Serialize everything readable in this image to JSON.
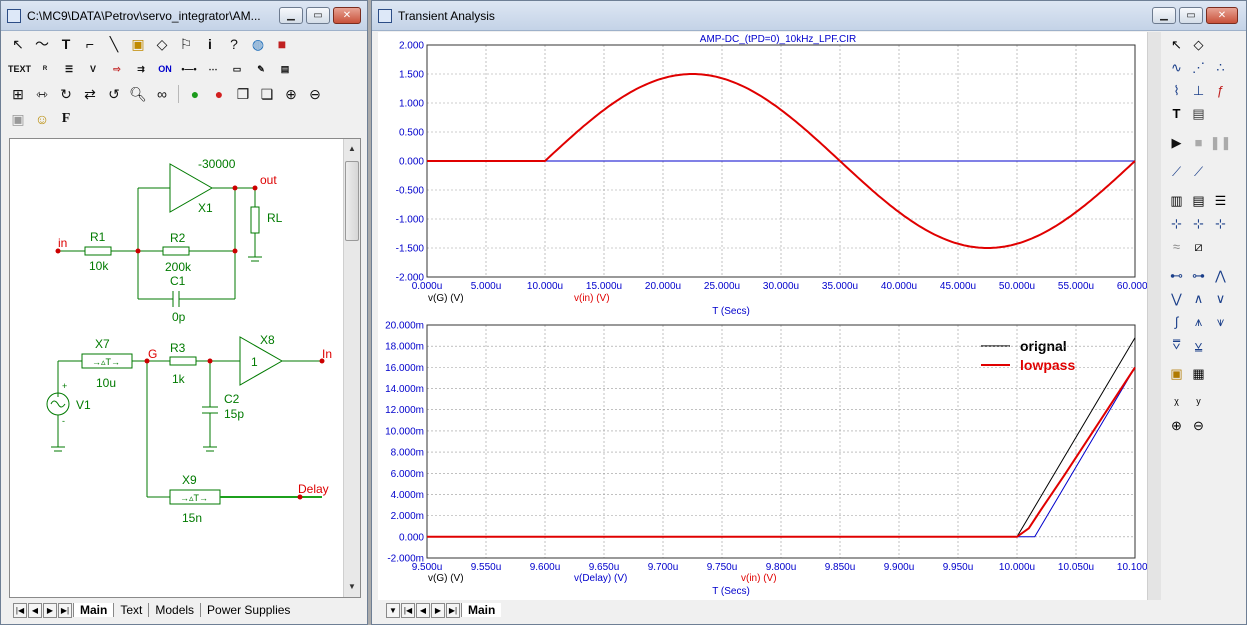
{
  "schematic_window": {
    "title": "C:\\MC9\\DATA\\Petrov\\servo_integrator\\AM...",
    "tabs": [
      "Main",
      "Text",
      "Models",
      "Power Supplies"
    ],
    "components": {
      "x1": {
        "name": "X1",
        "gain": "-30000"
      },
      "r1": {
        "name": "R1",
        "value": "10k"
      },
      "r2": {
        "name": "R2",
        "value": "200k"
      },
      "c1": {
        "name": "C1",
        "value": "0p"
      },
      "rl": {
        "name": "RL"
      },
      "x7": {
        "name": "X7",
        "value": "10u"
      },
      "r3": {
        "name": "R3",
        "value": "1k"
      },
      "c2": {
        "name": "C2",
        "value": "15p"
      },
      "x8": {
        "name": "X8",
        "gain": "1"
      },
      "v1": {
        "name": "V1"
      },
      "x9": {
        "name": "X9",
        "value": "15n"
      }
    },
    "nodes": {
      "in": "in",
      "out": "out",
      "g": "G",
      "in2": "In",
      "delay": "Delay"
    }
  },
  "analysis_window": {
    "title": "Transient Analysis",
    "tabs": [
      "Main"
    ],
    "plot1": {
      "title": "AMP-DC_(tPD=0)_10kHz_LPF.CIR",
      "y_ticks": [
        "2.000",
        "1.500",
        "1.000",
        "0.500",
        "0.000",
        "-0.500",
        "-1.000",
        "-1.500",
        "-2.000"
      ],
      "x_ticks": [
        "0.000u",
        "5.000u",
        "10.000u",
        "15.000u",
        "20.000u",
        "25.000u",
        "30.000u",
        "35.000u",
        "40.000u",
        "45.000u",
        "50.000u",
        "55.000u",
        "60.000u"
      ],
      "trace_labels": [
        "v(G) (V)",
        "v(in) (V)"
      ],
      "xlabel": "T (Secs)"
    },
    "plot2": {
      "y_ticks": [
        "20.000m",
        "18.000m",
        "16.000m",
        "14.000m",
        "12.000m",
        "10.000m",
        "8.000m",
        "6.000m",
        "4.000m",
        "2.000m",
        "0.000",
        "-2.000m"
      ],
      "x_ticks": [
        "9.500u",
        "9.550u",
        "9.600u",
        "9.650u",
        "9.700u",
        "9.750u",
        "9.800u",
        "9.850u",
        "9.900u",
        "9.950u",
        "10.000u",
        "10.050u",
        "10.100u"
      ],
      "trace_labels": [
        "v(G) (V)",
        "v(Delay) (V)",
        "v(in) (V)"
      ],
      "xlabel": "T (Secs)",
      "legend": [
        {
          "label": "orignal",
          "color": "#000000"
        },
        {
          "label": "lowpass",
          "color": "#E00000"
        }
      ]
    }
  },
  "chart_data": [
    {
      "type": "line",
      "title": "AMP-DC_(tPD=0)_10kHz_LPF.CIR",
      "xlabel": "T (Secs)",
      "xlim": [
        0,
        60
      ],
      "ylim": [
        -2,
        2
      ],
      "x_unit": "u",
      "series": [
        {
          "name": "v(G) (V)",
          "color": "#0000CC",
          "x": [
            0,
            60
          ],
          "y": [
            0,
            0
          ]
        },
        {
          "name": "v(in) (V)",
          "color": "#E00000",
          "x": [
            0,
            10,
            12.5,
            15,
            17.5,
            20,
            22.5,
            25,
            27.5,
            30,
            32.5,
            35,
            37.5,
            40,
            42.5,
            45,
            47.5,
            50,
            52.5,
            55,
            57.5,
            60
          ],
          "y": [
            0,
            0,
            0.388,
            0.75,
            1.061,
            1.299,
            1.449,
            1.5,
            1.449,
            1.299,
            1.061,
            0.75,
            0.388,
            0,
            -0.388,
            -0.75,
            -1.061,
            -1.299,
            -1.449,
            -1.5,
            -1.449,
            -1.299
          ]
        }
      ]
    },
    {
      "type": "line",
      "xlabel": "T (Secs)",
      "xlim": [
        9.5,
        10.1
      ],
      "ylim": [
        -0.002,
        0.02
      ],
      "x_unit": "u",
      "series": [
        {
          "name": "v(G) (V)",
          "color": "#000000",
          "x": [
            9.5,
            10.0,
            10.1
          ],
          "y": [
            0,
            0,
            0.0188
          ]
        },
        {
          "name": "v(Delay) (V)",
          "color": "#0000CC",
          "x": [
            9.5,
            10.015,
            10.1
          ],
          "y": [
            0,
            0,
            0.016
          ]
        },
        {
          "name": "v(in) (V)",
          "color": "#E00000",
          "x": [
            9.5,
            10.0,
            10.01,
            10.02,
            10.04,
            10.06,
            10.08,
            10.1
          ],
          "y": [
            0,
            0,
            0.0008,
            0.0025,
            0.0058,
            0.0092,
            0.0126,
            0.016
          ]
        }
      ]
    }
  ]
}
